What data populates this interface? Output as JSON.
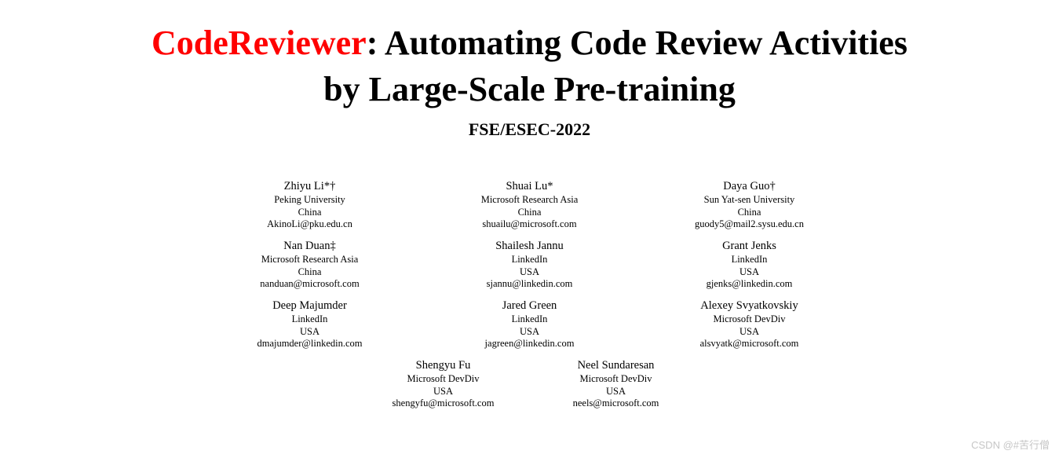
{
  "title": {
    "highlight": "CodeReviewer",
    "rest_line1": ": Automating Code Review Activities",
    "line2": "by Large-Scale Pre-training",
    "venue": "FSE/ESEC-2022"
  },
  "authors": {
    "row1": [
      {
        "name": "Zhiyu Li*†",
        "affil": "Peking University",
        "country": "China",
        "email": "AkinoLi@pku.edu.cn"
      },
      {
        "name": "Shuai Lu*",
        "affil": "Microsoft Research Asia",
        "country": "China",
        "email": "shuailu@microsoft.com"
      },
      {
        "name": "Daya Guo†",
        "affil": "Sun Yat-sen University",
        "country": "China",
        "email": "guody5@mail2.sysu.edu.cn"
      }
    ],
    "row2": [
      {
        "name": "Nan Duan‡",
        "affil": "Microsoft Research Asia",
        "country": "China",
        "email": "nanduan@microsoft.com"
      },
      {
        "name": "Shailesh Jannu",
        "affil": "LinkedIn",
        "country": "USA",
        "email": "sjannu@linkedin.com"
      },
      {
        "name": "Grant Jenks",
        "affil": "LinkedIn",
        "country": "USA",
        "email": "gjenks@linkedin.com"
      }
    ],
    "row3": [
      {
        "name": "Deep Majumder",
        "affil": "LinkedIn",
        "country": "USA",
        "email": "dmajumder@linkedin.com"
      },
      {
        "name": "Jared Green",
        "affil": "LinkedIn",
        "country": "USA",
        "email": "jagreen@linkedin.com"
      },
      {
        "name": "Alexey Svyatkovskiy",
        "affil": "Microsoft DevDiv",
        "country": "USA",
        "email": "alsvyatk@microsoft.com"
      }
    ],
    "row4": [
      {
        "name": "Shengyu Fu",
        "affil": "Microsoft DevDiv",
        "country": "USA",
        "email": "shengyfu@microsoft.com"
      },
      {
        "name": "Neel Sundaresan",
        "affil": "Microsoft DevDiv",
        "country": "USA",
        "email": "neels@microsoft.com"
      }
    ]
  },
  "watermark": "CSDN @#苦行僧"
}
